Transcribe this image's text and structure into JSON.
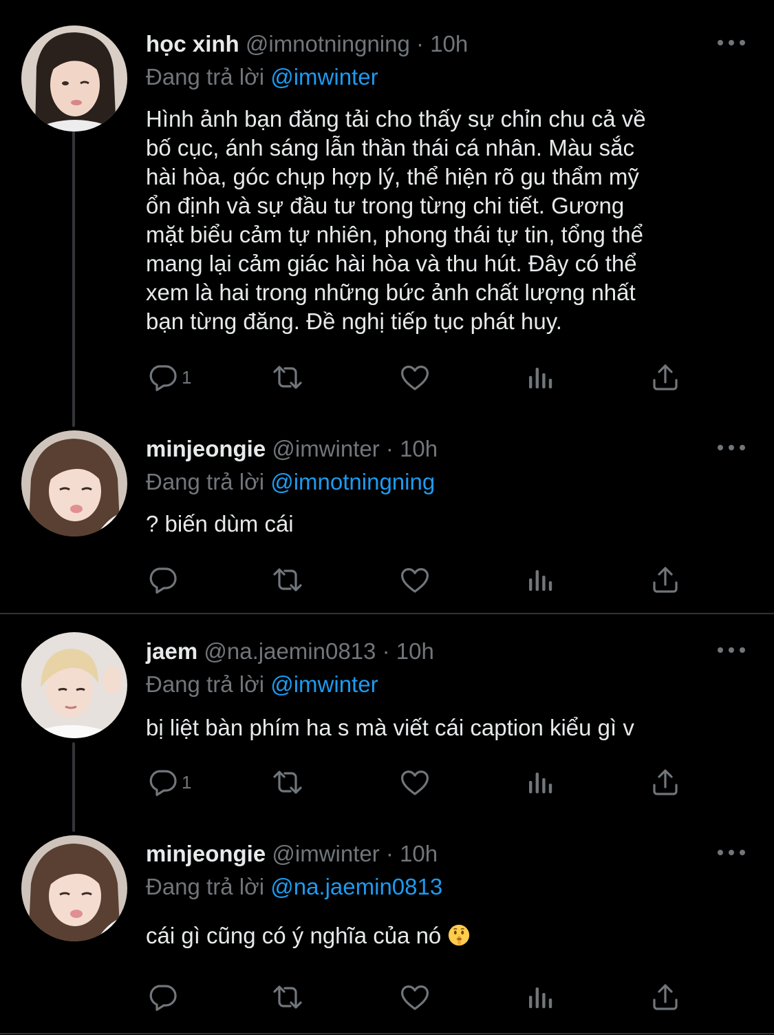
{
  "colors": {
    "background": "#000000",
    "primary_text": "#e7e9ea",
    "secondary_text": "#71767b",
    "mention": "#1d9bf0",
    "divider": "#2f3336"
  },
  "tweets": [
    {
      "name": "học xinh",
      "handle": "@imnotningning",
      "separator": "·",
      "time": "10h",
      "reply_prefix": "Đang trả lời",
      "reply_to": "@imwinter",
      "text_lines": [
        "Hình ảnh bạn đăng tải cho thấy sự chỉn chu cả về",
        "bố cục, ánh sáng lẫn thần thái cá nhân. Màu sắc",
        "hài hòa, góc chụp hợp lý, thể hiện rõ gu thẩm mỹ",
        "ổn định và sự đầu tư trong từng chi tiết. Gương",
        "mặt biểu cảm tự nhiên, phong thái tự tin, tổng thể",
        "mang lại cảm giác hài hòa và thu hút. Đây có thể",
        "xem là hai trong những bức ảnh chất lượng nhất",
        "bạn từng đăng. Đề nghị tiếp tục phát huy."
      ],
      "reply_count": "1",
      "avatar_icon": "avatar-long-dark-hair"
    },
    {
      "name": "minjeongie",
      "handle": "@imwinter",
      "separator": "·",
      "time": "10h",
      "reply_prefix": "Đang trả lời",
      "reply_to": "@imnotningning",
      "text": "? biến dùm cái",
      "reply_count": "",
      "avatar_icon": "avatar-pouting-girl"
    },
    {
      "name": "jaem",
      "handle": "@na.jaemin0813",
      "separator": "·",
      "time": "10h",
      "reply_prefix": "Đang trả lời",
      "reply_to": "@imwinter",
      "text": "bị liệt bàn phím ha s mà viết cái caption kiểu gì v",
      "reply_count": "1",
      "avatar_icon": "avatar-blond-boy"
    },
    {
      "name": "minjeongie",
      "handle": "@imwinter",
      "separator": "·",
      "time": "10h",
      "reply_prefix": "Đang trả lời",
      "reply_to": "@na.jaemin0813",
      "text": "cái gì cũng có ý nghĩa của nó",
      "emoji": "shushing-face-emoji",
      "reply_count": "",
      "avatar_icon": "avatar-pouting-girl"
    }
  ],
  "action_icons": [
    "reply-icon",
    "retweet-icon",
    "like-icon",
    "analytics-icon",
    "share-icon"
  ]
}
